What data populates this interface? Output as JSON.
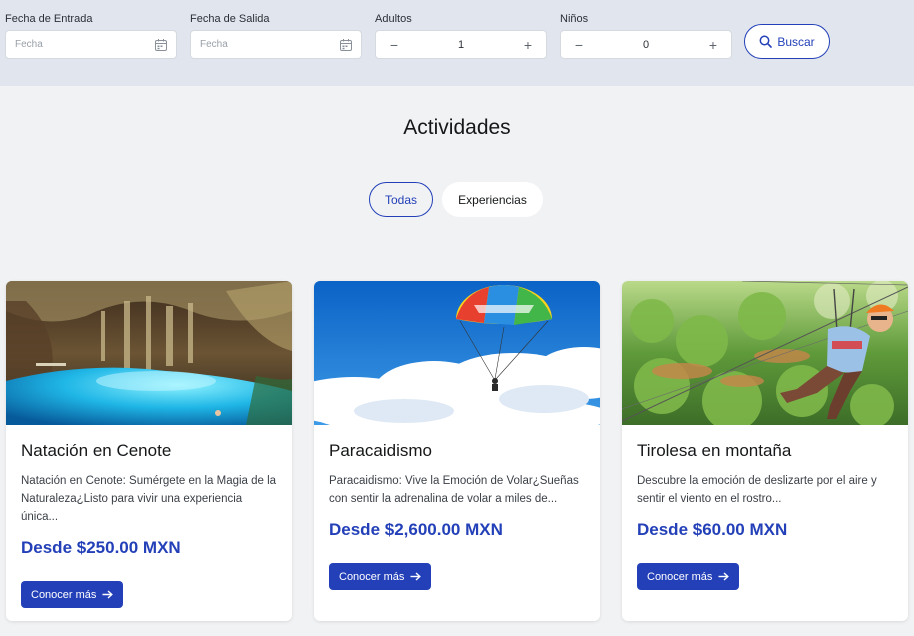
{
  "search": {
    "checkin": {
      "label": "Fecha de Entrada",
      "placeholder": "Fecha"
    },
    "checkout": {
      "label": "Fecha de Salida",
      "placeholder": "Fecha"
    },
    "adults": {
      "label": "Adultos",
      "value": "1",
      "minus": "−",
      "plus": "+"
    },
    "children": {
      "label": "Niños",
      "value": "0",
      "minus": "−",
      "plus": "+"
    },
    "button_label": "Buscar",
    "button_icon": "search-icon"
  },
  "section": {
    "title": "Actividades",
    "tabs": [
      {
        "label": "Todas",
        "active": true
      },
      {
        "label": "Experiencias",
        "active": false
      }
    ]
  },
  "cards": [
    {
      "title": "Natación en Cenote",
      "description": "Natación en Cenote: Sumérgete en la Magia de la Naturaleza¿Listo para vivir una experiencia única...",
      "price": "Desde $250.00 MXN",
      "button_label": "Conocer más",
      "image": "cenote-photo"
    },
    {
      "title": "Paracaidismo",
      "description": "Paracaidismo: Vive la Emoción de Volar¿Sueñas con sentir la adrenalina de volar a miles de...",
      "price": "Desde $2,600.00 MXN",
      "button_label": "Conocer más",
      "image": "parasailing-photo"
    },
    {
      "title": "Tirolesa en montaña",
      "description": "Descubre la emoción de deslizarte por el aire y sentir el viento en el rostro...",
      "price": "Desde $60.00 MXN",
      "button_label": "Conocer más",
      "image": "zipline-photo"
    }
  ],
  "colors": {
    "accent": "#2340b8",
    "searchbar_bg": "#e1e6ee",
    "page_bg": "#f1f2f4"
  }
}
